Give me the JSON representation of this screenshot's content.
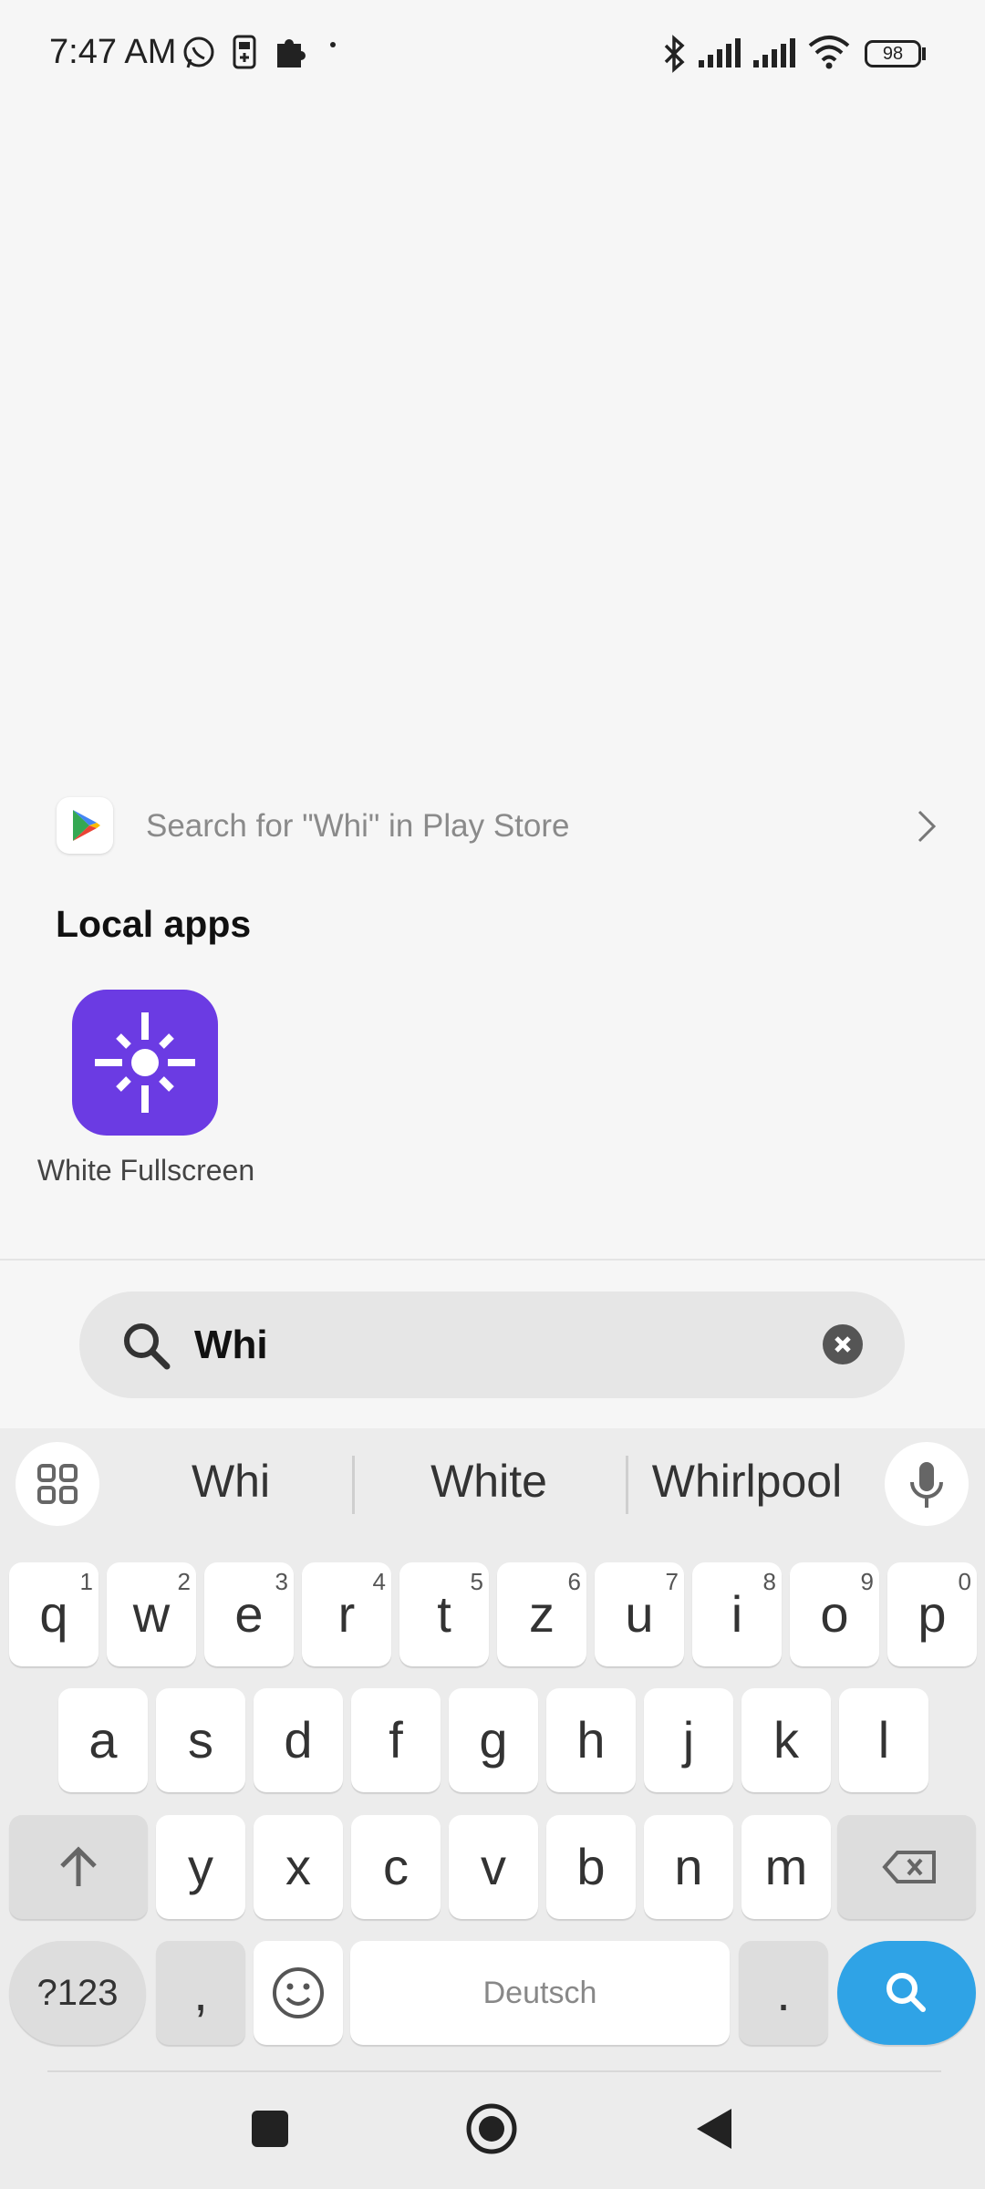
{
  "status_bar": {
    "time": "7:47 AM",
    "battery": "98"
  },
  "play_store": {
    "label": "Search for \"Whi\" in Play Store"
  },
  "local_apps": {
    "title": "Local apps",
    "apps": [
      {
        "label": "White Fullscreen",
        "icon": "brightness-sun-icon",
        "color": "#6b3be3"
      }
    ]
  },
  "search": {
    "query": "Whi"
  },
  "keyboard": {
    "suggestions": [
      "Whi",
      "White",
      "Whirlpool"
    ],
    "row1": [
      {
        "ch": "q",
        "n": "1"
      },
      {
        "ch": "w",
        "n": "2"
      },
      {
        "ch": "e",
        "n": "3"
      },
      {
        "ch": "r",
        "n": "4"
      },
      {
        "ch": "t",
        "n": "5"
      },
      {
        "ch": "z",
        "n": "6"
      },
      {
        "ch": "u",
        "n": "7"
      },
      {
        "ch": "i",
        "n": "8"
      },
      {
        "ch": "o",
        "n": "9"
      },
      {
        "ch": "p",
        "n": "0"
      }
    ],
    "row2": [
      "a",
      "s",
      "d",
      "f",
      "g",
      "h",
      "j",
      "k",
      "l"
    ],
    "row3": [
      "y",
      "x",
      "c",
      "v",
      "b",
      "n",
      "m"
    ],
    "symbols_label": "?123",
    "comma": ",",
    "space_label": "Deutsch",
    "period": ".",
    "accent_color": "#2fa3e6"
  }
}
